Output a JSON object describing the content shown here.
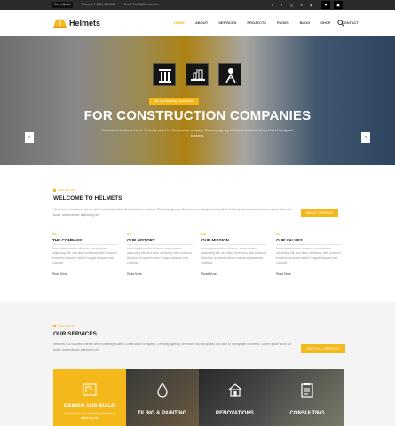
{
  "topbar": {
    "get_quote": "Get a Quote",
    "phone": "Phone: (+1 (586) 455-5555",
    "email": "Email: Email@Domain.com",
    "social_icons": [
      "facebook-icon",
      "twitter-icon",
      "google-plus-icon",
      "linkedin-icon",
      "rss-icon"
    ],
    "cart_icon": "cart-icon",
    "heart_icon": "heart-icon"
  },
  "header": {
    "logo": "Helmets",
    "nav": [
      "HOME",
      "ABOUT",
      "SERVICES",
      "PROJECTS",
      "PAGES",
      "BLOG",
      "SHOP",
      "CONTACT"
    ],
    "active": "HOME",
    "search_icon": "search-icon"
  },
  "hero": {
    "icons": [
      "column-icon",
      "building-icon",
      "worker-icon"
    ],
    "kicker": "We are Building Your Needs",
    "title": "FOR CONSTRUCTION COMPANIES",
    "description": "Helmets is a business theme. Perfectly suited for Construction company, Cleaning agency, Mechanic workshop & any kind of handyman business.",
    "slides": 2,
    "active_slide": 1
  },
  "welcome": {
    "eyebrow": "WHO WE ARE",
    "title": "WELCOME TO HELMETS",
    "text": "Helmets is a business theme which perfectly suited Construction company, Cleaning agency, Mechanic workshop and any kind of handyman business. Lorem ipsum dolor sit amet, consectetuer adipiscing elit.",
    "button": "ABOUT COMPANY",
    "features": [
      {
        "num": "01",
        "title": "THE COMPANY",
        "text": "Lorem ipsum dolor sit amet, consectetuer adipiscing elit, sed diam nonummy nibh euismod tincidunt ut laoreet dolore magna aliquam erat volutpat.",
        "more": "Read More"
      },
      {
        "num": "02",
        "title": "OUR HISTORY",
        "text": "Lorem ipsum dolor sit amet, consectetuer adipiscing elit, sed diam nonummy nibh euismod tincidunt ut laoreet dolore magna aliquam erat volutpat.",
        "more": "Read More"
      },
      {
        "num": "03",
        "title": "OUR MISSION",
        "text": "Lorem ipsum dolor sit amet, consectetuer adipiscing elit, sed diam nonummy nibh euismod tincidunt ut laoreet dolore magna aliquam erat volutpat.",
        "more": "Read More"
      },
      {
        "num": "04",
        "title": "OUR VALUES",
        "text": "Lorem ipsum dolor sit amet, consectetuer adipiscing elit, sed diam nonummy nibh euismod tincidunt ut laoreet dolore magna aliquam erat volutpat.",
        "more": "Read More"
      }
    ]
  },
  "services": {
    "eyebrow": "WHAT WE DO",
    "title": "OUR SERVICES",
    "text": "Helmets is a business theme which perfectly suited Construction company, Cleaning agency, Mechanic workshop and any kind of handyman business. Lorem ipsum dolor sit amet, consectetuer adipiscing elit.",
    "button": "CHECK ALL SERVICES",
    "cards": [
      {
        "label": "DESIGN AND BUILD",
        "sub": "Lorem ipsum dolor sit amet, consectetuer adipiscing elit.",
        "icon": "blueprint-icon"
      },
      {
        "label": "TILING & PAINTING",
        "icon": "paint-drop-icon"
      },
      {
        "label": "RENOVATIONS",
        "icon": "house-icon"
      },
      {
        "label": "CONSULTING",
        "icon": "clipboard-icon"
      }
    ]
  },
  "colors": {
    "accent": "#f5b81a",
    "topbar": "#2a2a2a",
    "text": "#333333"
  }
}
